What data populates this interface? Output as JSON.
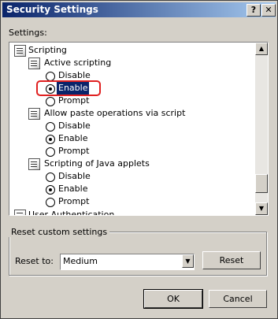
{
  "window": {
    "title": "Security Settings",
    "help_glyph": "?",
    "close_glyph": "✕"
  },
  "settings_label": "Settings:",
  "tree": {
    "root": "Scripting",
    "groups": [
      {
        "label": "Active scripting",
        "options": [
          "Disable",
          "Enable",
          "Prompt"
        ],
        "selected": "Enable"
      },
      {
        "label": "Allow paste operations via script",
        "options": [
          "Disable",
          "Enable",
          "Prompt"
        ],
        "selected": "Enable"
      },
      {
        "label": "Scripting of Java applets",
        "options": [
          "Disable",
          "Enable",
          "Prompt"
        ],
        "selected": "Enable"
      }
    ],
    "next_partial": "User Authentication"
  },
  "reset_group": {
    "legend": "Reset custom settings",
    "reset_to_label": "Reset to:",
    "reset_to_value": "Medium",
    "reset_button": "Reset"
  },
  "buttons": {
    "ok": "OK",
    "cancel": "Cancel"
  },
  "icons": {
    "scroll_up": "▲",
    "scroll_down": "▼",
    "dropdown": "▼"
  },
  "colors": {
    "titlebar_start": "#0a246a",
    "titlebar_end": "#a6caf0",
    "selection": "#0a246a",
    "highlight_ring": "#e02020",
    "dialog_bg": "#d4d0c8"
  }
}
